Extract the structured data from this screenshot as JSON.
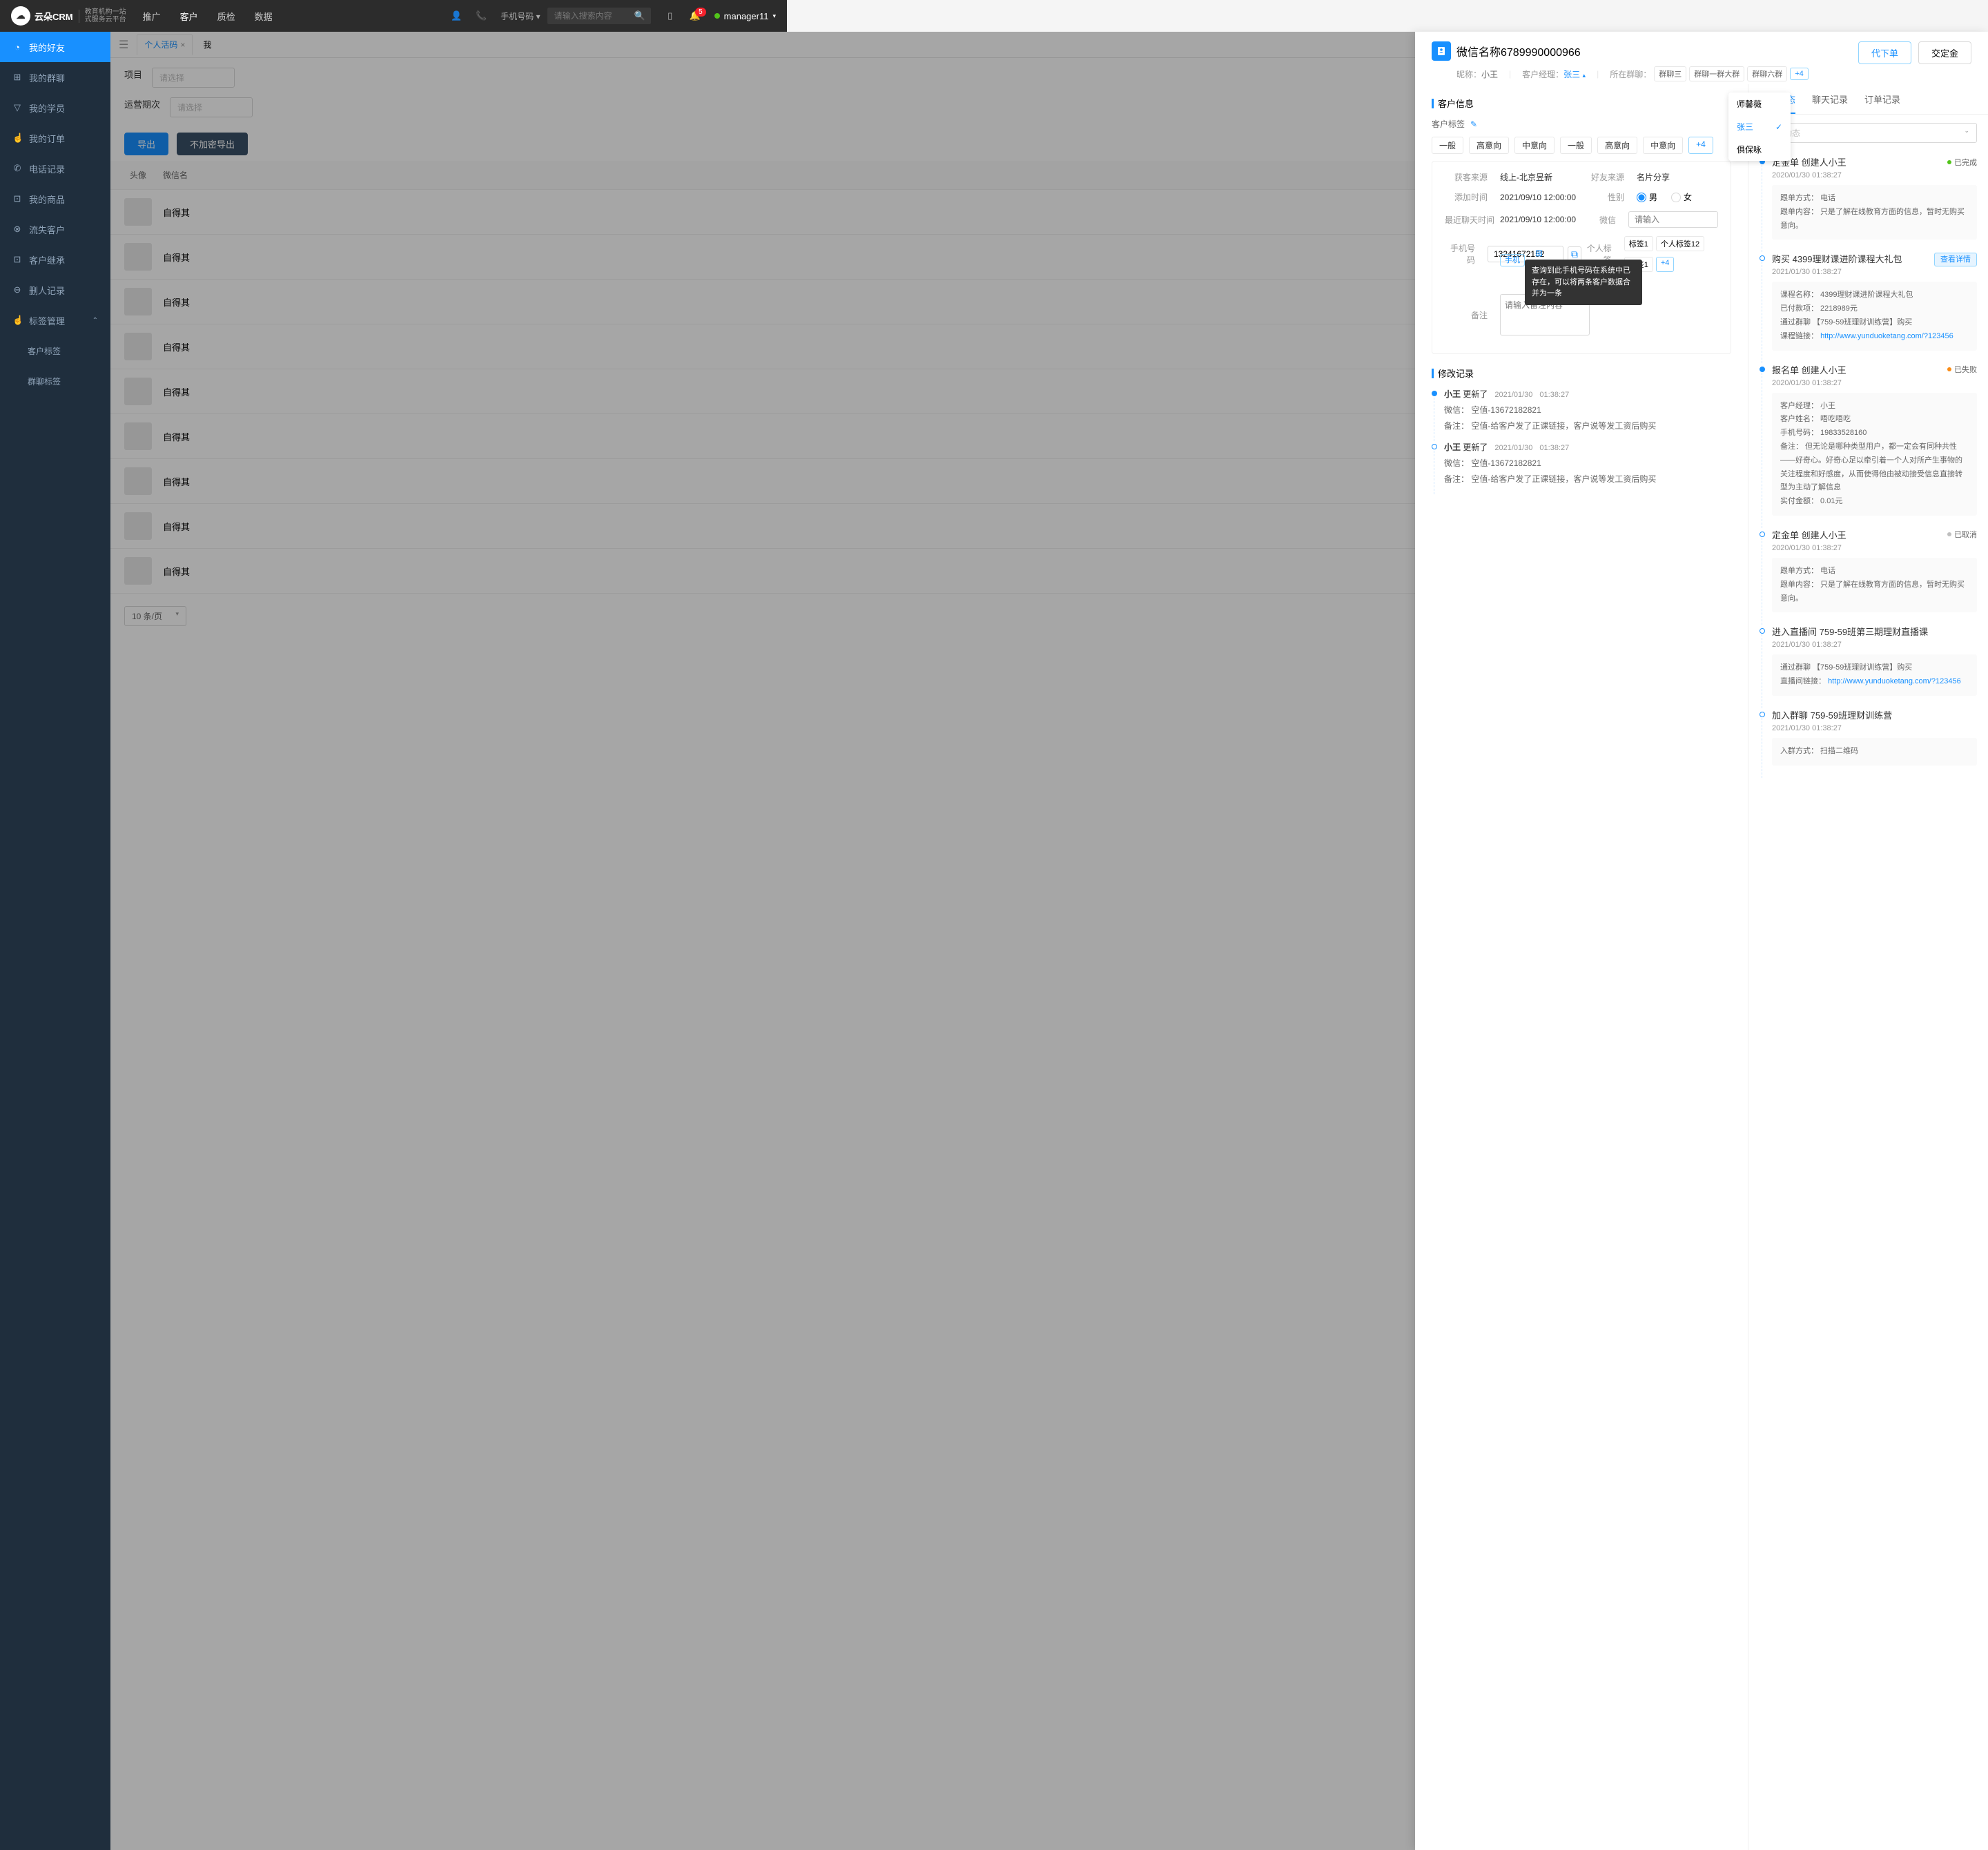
{
  "top": {
    "logo": "云朵CRM",
    "logoSub1": "教育机构一站",
    "logoSub2": "式服务云平台",
    "nav": [
      "推广",
      "客户",
      "质检",
      "数据"
    ],
    "navActive": "客户",
    "searchType": "手机号码",
    "searchPh": "请输入搜索内容",
    "badge": "5",
    "user": "manager11"
  },
  "side": [
    {
      "ico": "◔",
      "t": "我的好友",
      "on": true
    },
    {
      "ico": "⊞",
      "t": "我的群聊"
    },
    {
      "ico": "▽",
      "t": "我的学员"
    },
    {
      "ico": "☝",
      "t": "我的订单"
    },
    {
      "ico": "✆",
      "t": "电话记录"
    },
    {
      "ico": "⊡",
      "t": "我的商品"
    },
    {
      "ico": "⊗",
      "t": "流失客户"
    },
    {
      "ico": "⊡",
      "t": "客户继承"
    },
    {
      "ico": "⊖",
      "t": "删人记录"
    },
    {
      "ico": "☝",
      "t": "标签管理",
      "exp": true
    },
    {
      "sub": true,
      "t": "客户标签"
    },
    {
      "sub": true,
      "t": "群聊标签"
    }
  ],
  "tabs": {
    "active": "个人活码",
    "other": "我"
  },
  "filters": {
    "project": "项目",
    "period": "运营期次",
    "ph": "请选择",
    "export": "导出",
    "noenc": "不加密导出"
  },
  "listHdr": {
    "avatar": "头像",
    "name": "微信名"
  },
  "listRows": [
    "自得其",
    "自得其",
    "自得其",
    "自得其",
    "自得其",
    "自得其",
    "自得其",
    "自得其",
    "自得其"
  ],
  "pager": "10 条/页",
  "panel": {
    "title": "微信名称6789990000966",
    "nick": {
      "k": "昵称：",
      "v": "小王"
    },
    "mgr": {
      "k": "客户经理：",
      "v": "张三"
    },
    "grp": {
      "k": "所在群聊：",
      "v": [
        "群聊三",
        "群聊一群大群",
        "群聊六群"
      ],
      "more": "+4"
    },
    "btn1": "代下单",
    "btn2": "交定金",
    "dd": [
      "师馨薇",
      "张三",
      "俱保咏"
    ],
    "ddSel": "张三",
    "sec1": "客户信息",
    "tagLbl": "客户标签",
    "tags1": [
      "一般",
      "高意向",
      "中意向",
      "一般",
      "高意向",
      "中意向"
    ],
    "more4": "+4",
    "info": {
      "src": {
        "k": "获客来源",
        "v": "线上-北京昱新"
      },
      "fsrc": {
        "k": "好友来源",
        "v": "名片分享"
      },
      "addT": {
        "k": "添加时间",
        "v": "2021/09/10 12:00:00"
      },
      "sex": {
        "k": "性别",
        "m": "男",
        "f": "女"
      },
      "lastT": {
        "k": "最近聊天时间",
        "v": "2021/09/10 12:00:00"
      },
      "wx": {
        "k": "微信",
        "ph": "请输入"
      },
      "phone": {
        "k": "手机号码",
        "v": "13241672152",
        "chip": "手机"
      },
      "ptag": {
        "k": "个人标签",
        "v1": "标签1",
        "v2": "个人标签12",
        "v3": "标签1",
        "more": "+4"
      },
      "remark": {
        "k": "备注",
        "ph": "请输入备注内容"
      },
      "tooltip": "查询到此手机号码在系统中已存在，可以将两条客户数据合并为一条"
    },
    "sec2": "修改记录",
    "mods": [
      {
        "who": "小王",
        "act": "更新了",
        "t": "2021/01/30",
        "t2": "01:38:27",
        "lines": [
          "微信： 空值-13672182821",
          "备注： 空值-给客户发了正课链接，客户说等发工资后购买"
        ]
      },
      {
        "who": "小王",
        "act": "更新了",
        "t": "2021/01/30",
        "t2": "01:38:27",
        "lines": [
          "微信： 空值-13672182821",
          "备注： 空值-给客户发了正课链接，客户说等发工资后购买"
        ]
      }
    ],
    "rtabs": [
      "客户动态",
      "聊天记录",
      "订单记录"
    ],
    "filterAll": "全部动态",
    "feed": [
      {
        "f": true,
        "title": "定金单  创建人小王",
        "status": "已完成",
        "sd": "#52c41a",
        "t": "2020/01/30  01:38:27",
        "card": [
          "跟单方式：  电话",
          "跟单内容：  只是了解在线教育方面的信息，暂时无购买意向。"
        ]
      },
      {
        "title": "购买  4399理财课进阶课程大礼包",
        "link": "查看详情",
        "t": "2021/01/30  01:38:27",
        "card": [
          "课程名称：  4399理财课进阶课程大礼包",
          "已付款项：  2218989元",
          "通过群聊  【759-59班理财训练营】购买"
        ],
        "cardLink": "课程链接：  ",
        "url": "http://www.yunduoketang.com/?123456"
      },
      {
        "f": true,
        "title": "报名单  创建人小王",
        "status": "已失败",
        "sd": "#fa8c16",
        "t": "2020/01/30  01:38:27",
        "card": [
          "客户经理：  小王",
          "客户姓名：  唔吃唔吃",
          "手机号码：  19833528160",
          "       备注：   但无论是哪种类型用户，都一定会有同种共性——好奇心。好奇心足以牵引着一个人对所产生事物的关注程度和好感度，从而使得他由被动接受信息直接转型为主动了解信息",
          "实付金额：  0.01元"
        ]
      },
      {
        "title": "定金单  创建人小王",
        "status": "已取消",
        "sd": "#bfbfbf",
        "t": "2020/01/30  01:38:27",
        "card": [
          "跟单方式：  电话",
          "跟单内容：  只是了解在线教育方面的信息，暂时无购买意向。"
        ]
      },
      {
        "title": "进入直播间  759-59班第三期理财直播课",
        "t": "2021/01/30  01:38:27",
        "card": [
          "通过群聊  【759-59班理财训练营】购买"
        ],
        "cardLink": "直播间链接：  ",
        "url": "http://www.yunduoketang.com/?123456"
      },
      {
        "title": "加入群聊  759-59班理财训练营",
        "t": "2021/01/30  01:38:27",
        "card": [
          "入群方式：  扫描二维码"
        ]
      }
    ]
  }
}
